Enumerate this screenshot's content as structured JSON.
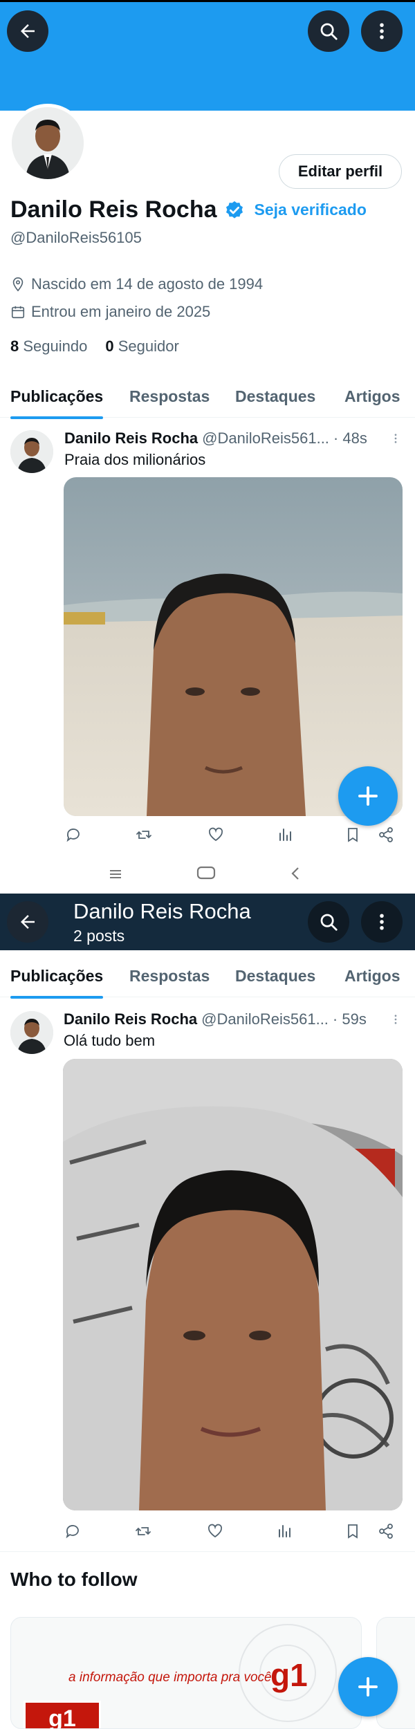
{
  "profile": {
    "name": "Danilo Reis Rocha",
    "verify_link": "Seja verificado",
    "handle": "@DaniloReis56105",
    "edit_button": "Editar perfil",
    "birth": "Nascido em 14 de agosto de 1994",
    "joined": "Entrou em janeiro de 2025",
    "following_count": "8",
    "following_label": "Seguindo",
    "followers_count": "0",
    "followers_label": "Seguidor"
  },
  "tabs": [
    "Publicações",
    "Respostas",
    "Destaques",
    "Artigos"
  ],
  "header2": {
    "title": "Danilo Reis Rocha",
    "subtitle": "2 posts"
  },
  "posts": [
    {
      "author": "Danilo Reis Rocha",
      "handle": "@DaniloReis561...",
      "time": "· 48s",
      "text": "Praia dos milionários"
    },
    {
      "author": "Danilo Reis Rocha",
      "handle": "@DaniloReis561...",
      "time": "· 59s",
      "text": "Olá tudo bem"
    }
  ],
  "who_to_follow": {
    "title": "Who to follow",
    "card_tagline": "a informação que importa pra você",
    "card_logo": "g1"
  },
  "colors": {
    "accent": "#1d9bf0",
    "header_blue": "#1d9bf0",
    "dark_header": "#142a3d"
  },
  "icons": [
    "back-arrow-icon",
    "search-icon",
    "more-vertical-icon",
    "verified-badge-icon",
    "location-pin-icon",
    "calendar-icon",
    "reply-icon",
    "retweet-icon",
    "like-icon",
    "views-icon",
    "bookmark-icon",
    "share-icon",
    "plus-icon"
  ]
}
